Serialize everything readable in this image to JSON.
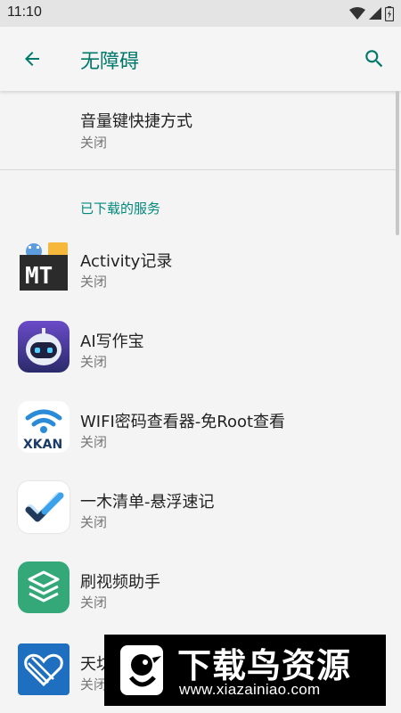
{
  "status_bar": {
    "time": "11:10"
  },
  "header": {
    "title": "无障碍",
    "back_icon": "arrow-left-icon",
    "search_icon": "search-icon"
  },
  "colors": {
    "accent": "#00796b",
    "category": "#00897b"
  },
  "shortcut": {
    "title": "音量键快捷方式",
    "summary": "关闭"
  },
  "category_label": "已下载的服务",
  "services": [
    {
      "title": "Activity记录",
      "summary": "关闭",
      "icon": "mt-manager-icon"
    },
    {
      "title": "AI写作宝",
      "summary": "关闭",
      "icon": "ai-robot-icon"
    },
    {
      "title": "WIFI密码查看器-免Root查看",
      "summary": "关闭",
      "icon": "xkan-wifi-icon"
    },
    {
      "title": "一木清单-悬浮速记",
      "summary": "关闭",
      "icon": "checkmark-app-icon"
    },
    {
      "title": "刷视频助手",
      "summary": "关闭",
      "icon": "stack-app-icon"
    },
    {
      "title": "天坊",
      "summary": "关闭",
      "icon": "blue-heart-app-icon"
    }
  ],
  "watermark": {
    "title": "下载鸟资源",
    "url": "www.xiazainiao.com"
  }
}
